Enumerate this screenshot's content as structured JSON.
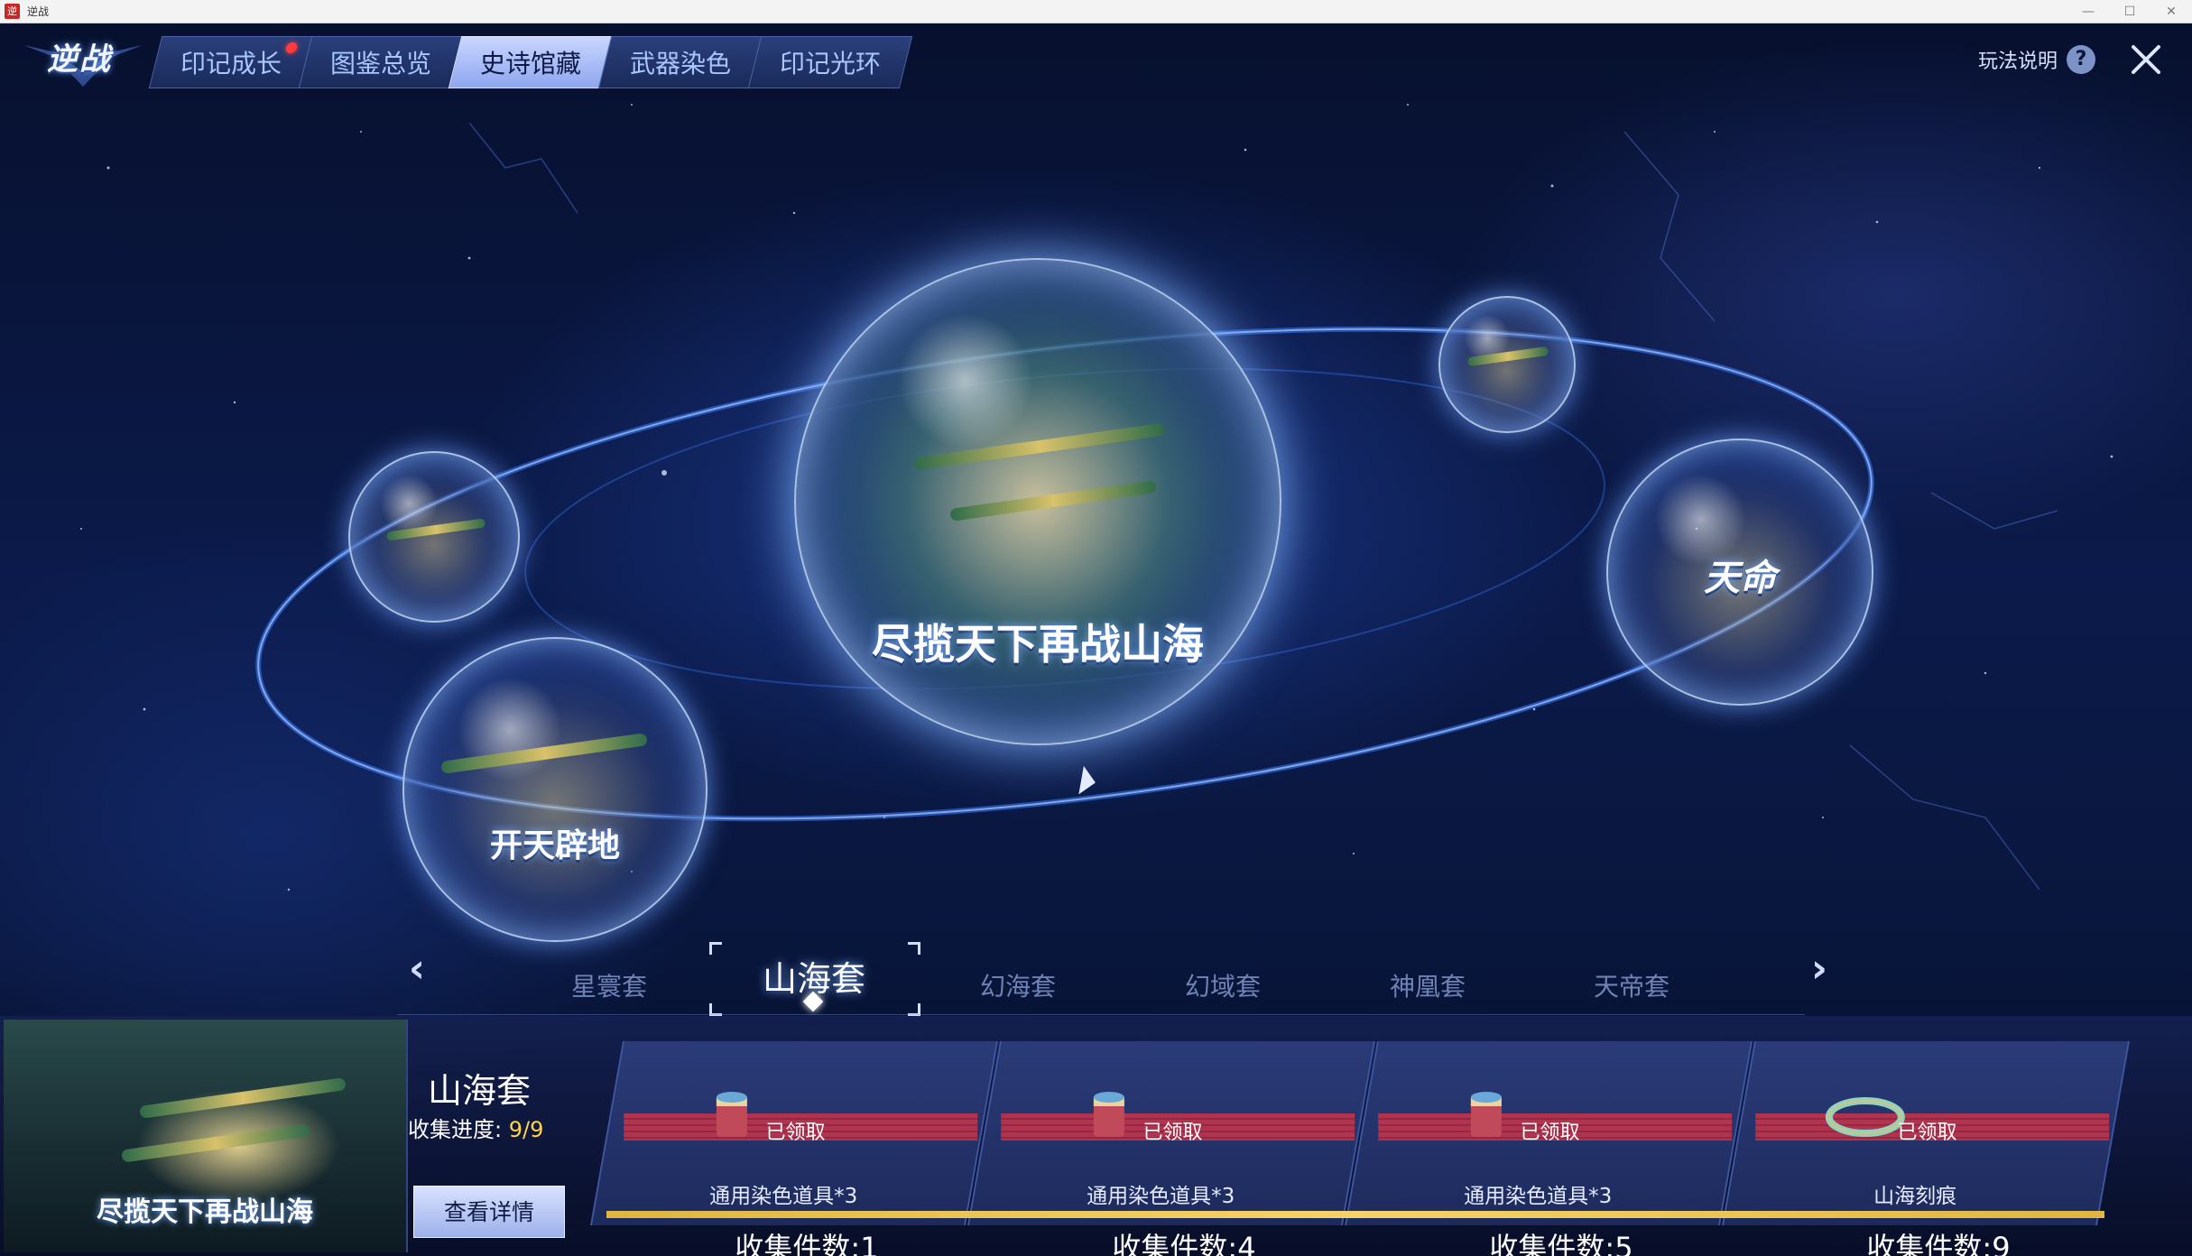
{
  "window": {
    "title": "逆战",
    "app_icon": "逆",
    "controls": [
      "—",
      "☐",
      "✕"
    ]
  },
  "game": {
    "logo": "逆战",
    "tabs": [
      {
        "label": "印记成长",
        "has_notification": true
      },
      {
        "label": "图鉴总览",
        "has_notification": false
      },
      {
        "label": "史诗馆藏",
        "has_notification": false,
        "active": true
      },
      {
        "label": "武器染色",
        "has_notification": false
      },
      {
        "label": "印记光环",
        "has_notification": false
      }
    ],
    "help_label": "玩法说明",
    "help_icon": "?",
    "sphere_captions": {
      "main": "尽揽天下再战山海",
      "lower_left": "开天辟地",
      "right": "天命"
    },
    "sets": {
      "prev_icon": "chevron-left-icon",
      "next_icon": "chevron-right-icon",
      "items": [
        "星寰套",
        "山海套",
        "幻海套",
        "幻域套",
        "神凰套",
        "天帝套"
      ],
      "active_index": 1
    },
    "selected_set": {
      "name": "山海套",
      "progress_label": "收集进度:",
      "progress_value": "9/9",
      "thumb_caption": "尽揽天下再战山海",
      "details_button": "查看详情"
    },
    "rewards": [
      {
        "status": "已领取",
        "name": "通用染色道具*3",
        "count_label": "收集件数:1",
        "icon": "paint-bucket-icon"
      },
      {
        "status": "已领取",
        "name": "通用染色道具*3",
        "count_label": "收集件数:4",
        "icon": "paint-bucket-icon"
      },
      {
        "status": "已领取",
        "name": "通用染色道具*3",
        "count_label": "收集件数:5",
        "icon": "paint-bucket-icon"
      },
      {
        "status": "已领取",
        "name": "山海刻痕",
        "count_label": "收集件数:9",
        "icon": "jade-ring-icon"
      }
    ],
    "colors": {
      "accent": "#8ea6ef",
      "claimed_bar": "#b03350",
      "progress_value": "#ffd24a",
      "gold_line": "#e0b640",
      "notification": "#ff3a3a"
    }
  }
}
